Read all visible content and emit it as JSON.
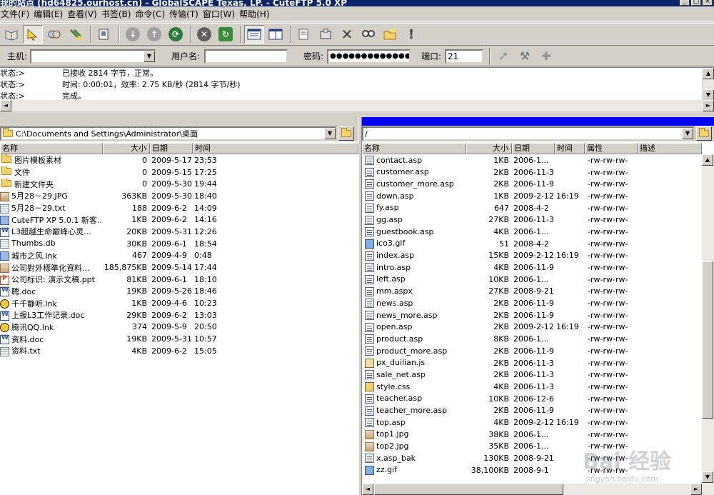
{
  "title_bar": {
    "text": "我的站点 (hd64825.ourhost.cn) - GlobalSCAPE Texas, LP. - CuteFTP 5.0 XP"
  },
  "menu": [
    "文件(F)",
    "编辑(E)",
    "查看(V)",
    "书签(B)",
    "命令(C)",
    "传输(T)",
    "窗口(W)",
    "帮助(H)"
  ],
  "toolbar": {
    "icons": [
      "site-manager-icon",
      "connect-icon",
      "quick-connect-icon",
      "disconnect-icon",
      "view-icon",
      "download-icon",
      "upload-icon",
      "refresh-icon",
      "stop-icon",
      "reload-icon",
      "list-view-icon",
      "detail-view-icon",
      "edit-icon",
      "chmod-icon",
      "delete-icon",
      "find-icon",
      "new-folder-icon",
      "alert-icon"
    ]
  },
  "connection": {
    "host_label": "主机:",
    "host_value": "",
    "user_label": "用户名:",
    "user_value": "",
    "pass_label": "密码:",
    "pass_value": "●●●●●●●●●●●●●",
    "port_label": "端口:",
    "port_value": "21"
  },
  "log": [
    {
      "k": "状态:>",
      "v": "已接收 2814 字节，正常。"
    },
    {
      "k": "状态:>",
      "v": "时间: 0:00:01，效率: 2.75 KB/秒 (2814 字节/秒)"
    },
    {
      "k": "状态:>",
      "v": "完成。"
    }
  ],
  "local": {
    "path": "C:\\Documents and Settings\\Administrator\\桌面",
    "columns": [
      "名称",
      "大小",
      "日期",
      "时间"
    ],
    "files": [
      {
        "icon": "folder",
        "name": "图片模板素材",
        "size": "0",
        "date": "2009-5-17",
        "time": "23:53"
      },
      {
        "icon": "folder",
        "name": "文件",
        "size": "0",
        "date": "2009-5-15",
        "time": "17:25"
      },
      {
        "icon": "folder",
        "name": "新建文件夹",
        "size": "0",
        "date": "2009-5-30",
        "time": "19:44"
      },
      {
        "icon": "img",
        "name": "5月28－29.JPG",
        "size": "363KB",
        "date": "2009-5-30",
        "time": "18:40"
      },
      {
        "icon": "txt",
        "name": "5月28－29.txt",
        "size": "188",
        "date": "2009-6-2",
        "time": "14:09"
      },
      {
        "icon": "lnk",
        "name": "CuteFTP XP 5.0.1 新客...",
        "size": "1KB",
        "date": "2009-6-2",
        "time": "14:16"
      },
      {
        "icon": "doc",
        "name": "L3超越生命巅峰心灵...",
        "size": "20KB",
        "date": "2009-5-31",
        "time": "12:26"
      },
      {
        "icon": "txt",
        "name": "Thumbs.db",
        "size": "30KB",
        "date": "2009-6-1",
        "time": "18:54"
      },
      {
        "icon": "lnk",
        "name": "城市之风.lnk",
        "size": "467",
        "date": "2009-4-9",
        "time": "0:48"
      },
      {
        "icon": "img",
        "name": "公司對外標準化資料...",
        "size": "185,875KB",
        "date": "2009-5-14",
        "time": "17:44"
      },
      {
        "icon": "ppt",
        "name": "公司标识: 演示文稿.ppt",
        "size": "81KB",
        "date": "2009-6-1",
        "time": "18:10"
      },
      {
        "icon": "doc",
        "name": "聘.doc",
        "size": "19KB",
        "date": "2009-5-26",
        "time": "18:46"
      },
      {
        "icon": "qq",
        "name": "千千静听.lnk",
        "size": "1KB",
        "date": "2009-4-6",
        "time": "10:23"
      },
      {
        "icon": "doc",
        "name": "上报L3工作记录.doc",
        "size": "29KB",
        "date": "2009-6-2",
        "time": "13:03"
      },
      {
        "icon": "qq",
        "name": "腾讯QQ.lnk",
        "size": "374",
        "date": "2009-5-9",
        "time": "20:50"
      },
      {
        "icon": "doc",
        "name": "资料.doc",
        "size": "19KB",
        "date": "2009-5-31",
        "time": "10:57"
      },
      {
        "icon": "txt",
        "name": "资料.txt",
        "size": "4KB",
        "date": "2009-6-2",
        "time": "15:05"
      }
    ]
  },
  "remote": {
    "path": "/",
    "columns": [
      "名称",
      "大小",
      "日期",
      "时间",
      "属性",
      "描述"
    ],
    "files": [
      {
        "icon": "web",
        "name": "contact.asp",
        "size": "1KB",
        "date": "2006-1...",
        "time": "",
        "attr": "-rw-rw-rw-"
      },
      {
        "icon": "web",
        "name": "customer.asp",
        "size": "2KB",
        "date": "2006-11-3",
        "time": "",
        "attr": "-rw-rw-rw-"
      },
      {
        "icon": "web",
        "name": "customer_more.asp",
        "size": "2KB",
        "date": "2006-11-9",
        "time": "",
        "attr": "-rw-rw-rw-"
      },
      {
        "icon": "web",
        "name": "down.asp",
        "size": "1KB",
        "date": "2009-2-12",
        "time": "16:19",
        "attr": "-rw-rw-rw-"
      },
      {
        "icon": "web",
        "name": "fy.asp",
        "size": "647",
        "date": "2008-4-2",
        "time": "",
        "attr": "-rw-rw-rw-"
      },
      {
        "icon": "web",
        "name": "gg.asp",
        "size": "27KB",
        "date": "2006-11-3",
        "time": "",
        "attr": "-rw-rw-rw-"
      },
      {
        "icon": "web",
        "name": "guestbook.asp",
        "size": "4KB",
        "date": "2006-1...",
        "time": "",
        "attr": "-rw-rw-rw-"
      },
      {
        "icon": "gif",
        "name": "ico3.gif",
        "size": "51",
        "date": "2008-4-2",
        "time": "",
        "attr": "-rw-rw-rw-"
      },
      {
        "icon": "web",
        "name": "index.asp",
        "size": "15KB",
        "date": "2009-2-12",
        "time": "16:19",
        "attr": "-rw-rw-rw-"
      },
      {
        "icon": "web",
        "name": "intro.asp",
        "size": "4KB",
        "date": "2006-11-9",
        "time": "",
        "attr": "-rw-rw-rw-"
      },
      {
        "icon": "web",
        "name": "left.asp",
        "size": "10KB",
        "date": "2006-1...",
        "time": "",
        "attr": "-rw-rw-rw-"
      },
      {
        "icon": "web",
        "name": "mm.aspx",
        "size": "27KB",
        "date": "2008-9-21",
        "time": "",
        "attr": "-rw-rw-rw-"
      },
      {
        "icon": "web",
        "name": "news.asp",
        "size": "2KB",
        "date": "2006-11-9",
        "time": "",
        "attr": "-rw-rw-rw-"
      },
      {
        "icon": "web",
        "name": "news_more.asp",
        "size": "2KB",
        "date": "2006-11-9",
        "time": "",
        "attr": "-rw-rw-rw-"
      },
      {
        "icon": "web",
        "name": "open.asp",
        "size": "2KB",
        "date": "2009-2-12",
        "time": "16:19",
        "attr": "-rw-rw-rw-"
      },
      {
        "icon": "web",
        "name": "product.asp",
        "size": "8KB",
        "date": "2006-1...",
        "time": "",
        "attr": "-rw-rw-rw-"
      },
      {
        "icon": "web",
        "name": "product_more.asp",
        "size": "2KB",
        "date": "2006-11-9",
        "time": "",
        "attr": "-rw-rw-rw-"
      },
      {
        "icon": "js",
        "name": "px_duilian.js",
        "size": "2KB",
        "date": "2006-11-3",
        "time": "",
        "attr": "-rw-rw-rw-"
      },
      {
        "icon": "web",
        "name": "sale_net.asp",
        "size": "2KB",
        "date": "2006-11-3",
        "time": "",
        "attr": "-rw-rw-rw-"
      },
      {
        "icon": "css",
        "name": "style.css",
        "size": "4KB",
        "date": "2006-11-3",
        "time": "",
        "attr": "-rw-rw-rw-"
      },
      {
        "icon": "web",
        "name": "teacher.asp",
        "size": "10KB",
        "date": "2006-12-6",
        "time": "",
        "attr": "-rw-rw-rw-"
      },
      {
        "icon": "web",
        "name": "teacher_more.asp",
        "size": "2KB",
        "date": "2006-11-9",
        "time": "",
        "attr": "-rw-rw-rw-"
      },
      {
        "icon": "web",
        "name": "top.asp",
        "size": "4KB",
        "date": "2009-2-12",
        "time": "16:19",
        "attr": "-rw-rw-rw-"
      },
      {
        "icon": "img",
        "name": "top1.jpg",
        "size": "38KB",
        "date": "2006-1...",
        "time": "",
        "attr": "-rw-rw-rw-"
      },
      {
        "icon": "img",
        "name": "top2.jpg",
        "size": "35KB",
        "date": "2006-1...",
        "time": "",
        "attr": "-rw-rw-rw-"
      },
      {
        "icon": "web",
        "name": "x.asp_bak",
        "size": "130KB",
        "date": "2008-9-21",
        "time": "",
        "attr": "-rw-rw-rw-"
      },
      {
        "icon": "gif",
        "name": "zz.gif",
        "size": "38,100KB",
        "date": "2008-9-1",
        "time": "",
        "attr": "-rw-rw-rw-"
      }
    ]
  },
  "watermark": {
    "main": "Bai 经验",
    "sub": "jingyan.baidu.com"
  }
}
